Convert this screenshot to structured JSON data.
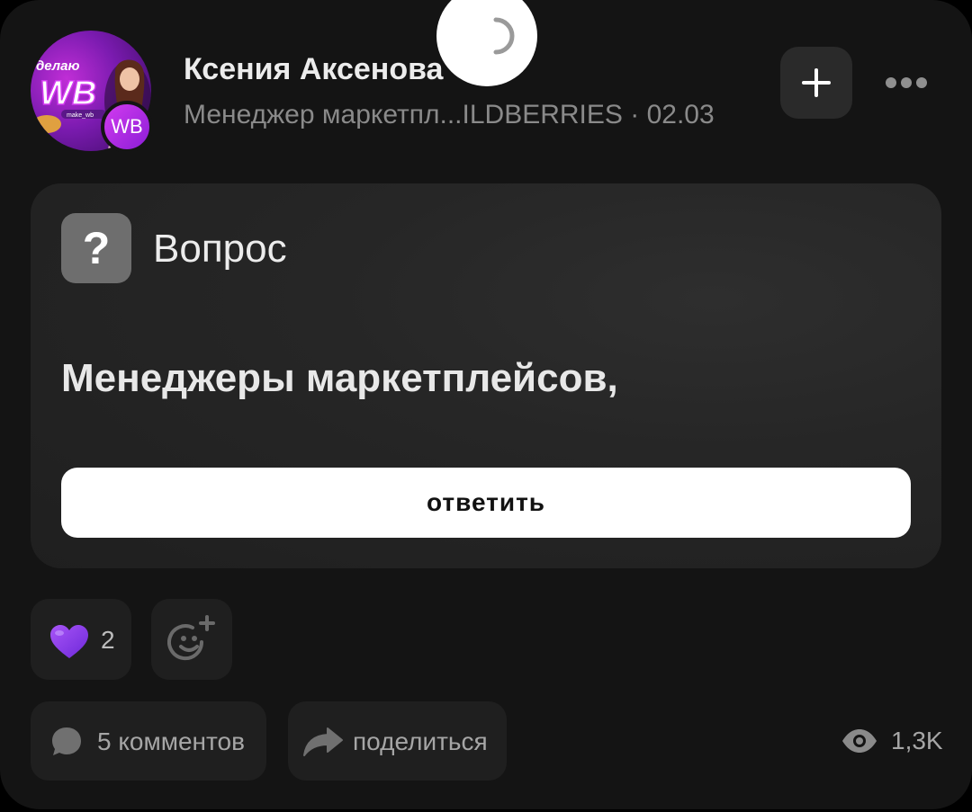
{
  "author": {
    "name": "Ксения Аксенова",
    "subtitle": "Менеджер маркетпл...ILDBERRIES · 02.03",
    "avatar_text": "делаю",
    "avatar_brand": "WB",
    "avatar_handle": "make_wb",
    "badge": "WB"
  },
  "header": {
    "add_icon": "plus-icon",
    "more_icon": "more-horizontal-icon"
  },
  "question": {
    "label": "Вопрос",
    "icon_glyph": "?",
    "text": "Менеджеры маркетплейсов,",
    "answer_button": "ответить"
  },
  "reactions": {
    "like_icon": "heart-icon",
    "like_count": "2",
    "add_reaction_icon": "add-emoji-icon"
  },
  "actions": {
    "comments": "5 комментов",
    "share": "поделиться",
    "views": "1,3K"
  },
  "colors": {
    "card_background": "#141414",
    "accent_purple": "#8b2ff0",
    "badge_gradient_start": "#d33bf0",
    "badge_gradient_end": "#8b1ed6",
    "muted_text": "#8a8a8a",
    "button_white": "#ffffff"
  }
}
